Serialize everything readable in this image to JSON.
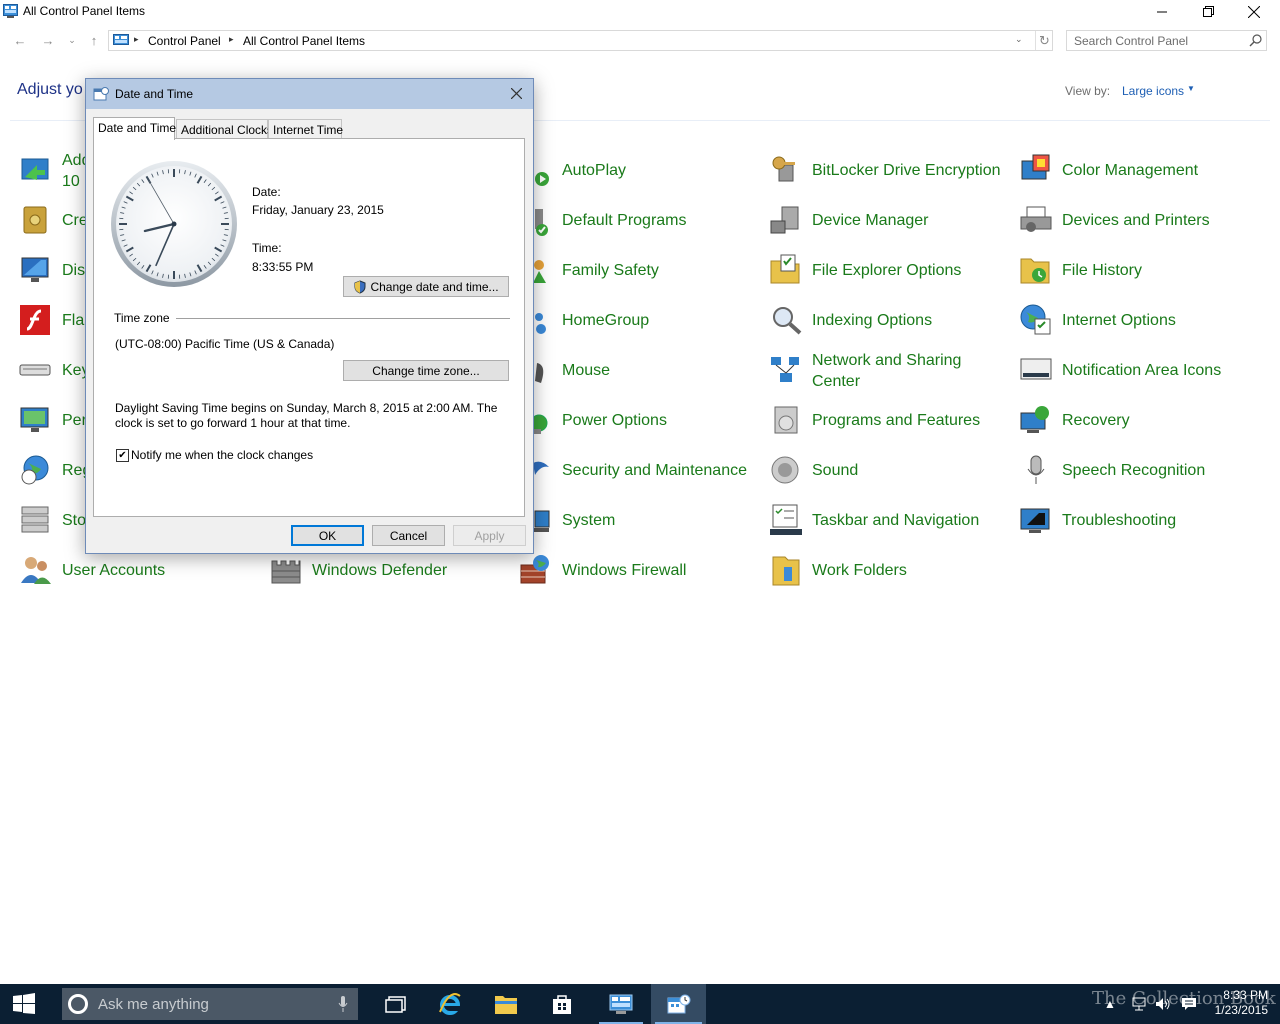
{
  "window": {
    "title": "All Control Panel Items"
  },
  "address": {
    "crumbs": [
      "Control Panel",
      "All Control Panel Items"
    ],
    "search_placeholder": "Search Control Panel"
  },
  "header": {
    "adjust_text": "Adjust yo",
    "view_by_label": "View by:",
    "view_by_value": "Large icons"
  },
  "items": {
    "c0": [
      "Add",
      "Cre",
      "Dis",
      "Flas",
      "Key",
      "Per",
      "Reg",
      "Sto",
      "User Accounts"
    ],
    "c0_add_line2": "10",
    "c1": [
      "Windows Defender"
    ],
    "c2": [
      "AutoPlay",
      "Default Programs",
      "Family Safety",
      "HomeGroup",
      "Mouse",
      "Power Options",
      "Security and Maintenance",
      "System",
      "Windows Firewall"
    ],
    "c3": [
      "BitLocker Drive Encryption",
      "Device Manager",
      "File Explorer Options",
      "Indexing Options",
      "Network and Sharing",
      "Programs and Features",
      "Sound",
      "Taskbar and Navigation",
      "Work Folders"
    ],
    "c3_network_line2": "Center",
    "c4": [
      "Color Management",
      "Devices and Printers",
      "File History",
      "Internet Options",
      "Notification Area Icons",
      "Recovery",
      "Speech Recognition",
      "Troubleshooting"
    ]
  },
  "dialog": {
    "title": "Date and Time",
    "tabs": [
      "Date and Time",
      "Additional Clocks",
      "Internet Time"
    ],
    "date_label": "Date:",
    "date_value": "Friday, January 23, 2015",
    "time_label": "Time:",
    "time_value": "8:33:55 PM",
    "change_datetime_btn": "Change date and time...",
    "timezone_header": "Time zone",
    "timezone_value": "(UTC-08:00) Pacific Time (US & Canada)",
    "change_timezone_btn": "Change time zone...",
    "dst_line1": "Daylight Saving Time begins on Sunday, March 8, 2015 at 2:00 AM. The",
    "dst_line2": "clock is set to go forward 1 hour at that time.",
    "notify_label": "Notify me when the clock changes",
    "notify_checked": true,
    "ok": "OK",
    "cancel": "Cancel",
    "apply": "Apply",
    "clock_time": {
      "hour": 8,
      "minute": 33,
      "second": 55
    }
  },
  "taskbar": {
    "search_placeholder": "Ask me anything",
    "clock_time": "8:33 PM",
    "clock_date": "1/23/2015",
    "watermark": "The Collection Book"
  },
  "colors": {
    "item_link": "#1a7a1a",
    "heading": "#1e3287",
    "dialog_title_bg": "#b5c9e3",
    "taskbar_bg": "#0b1f33"
  }
}
